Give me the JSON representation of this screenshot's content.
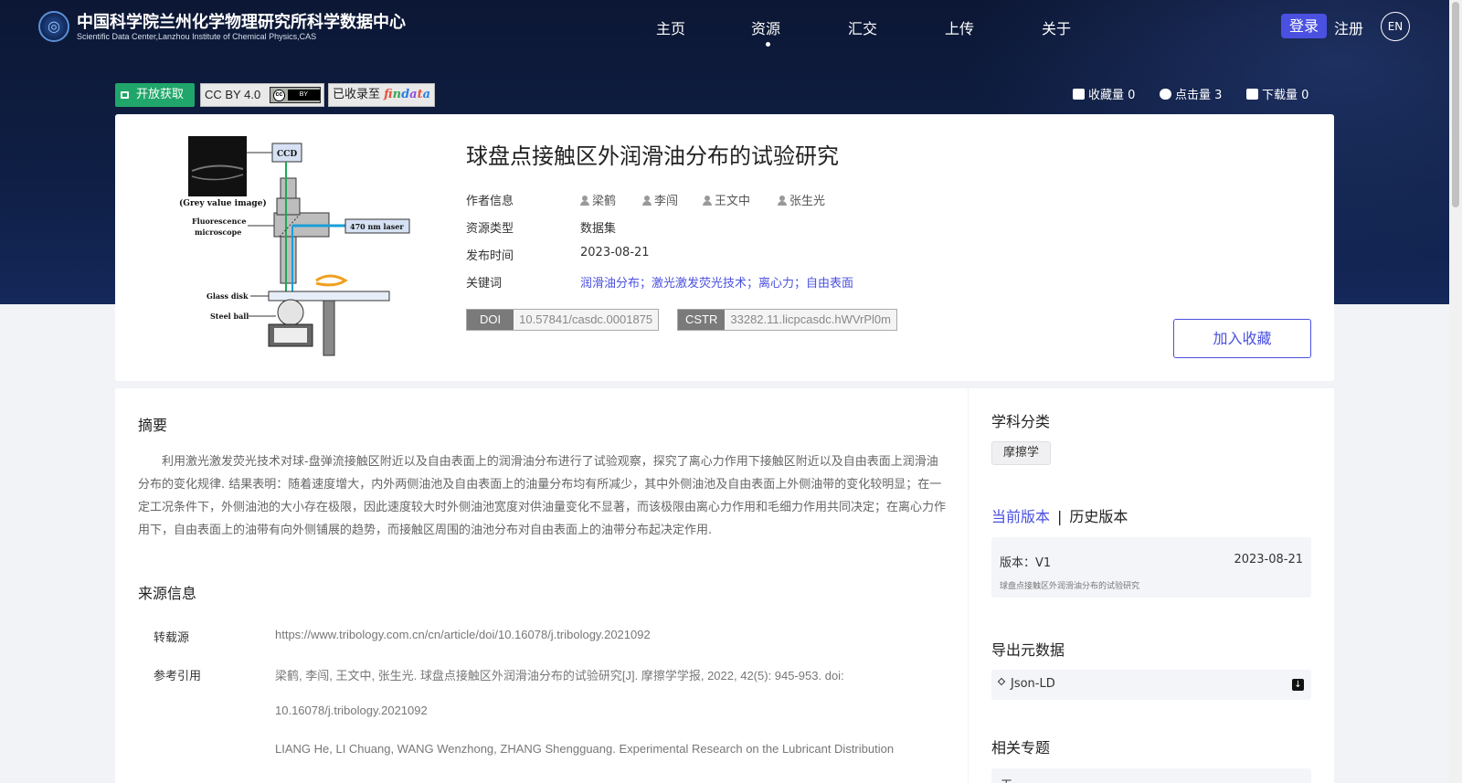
{
  "header": {
    "title": "中国科学院兰州化学物理研究所科学数据中心",
    "subtitle": "Scientific Data Center,Lanzhou Institute of Chemical Physics,CAS",
    "nav": [
      "主页",
      "资源",
      "汇交",
      "上传",
      "关于"
    ],
    "active_nav": "资源",
    "login": "登录",
    "register": "注册",
    "lang": "EN"
  },
  "badges": {
    "open_access": "开放获取",
    "license": "CC BY 4.0",
    "indexed_prefix": "已收录至",
    "indexed_logo": "findata"
  },
  "stats": [
    {
      "icon": "bookmark-icon",
      "label": "收藏量",
      "value": "0"
    },
    {
      "icon": "eye-icon",
      "label": "点击量",
      "value": "3"
    },
    {
      "icon": "download-icon",
      "label": "下载量",
      "value": "0"
    }
  ],
  "resource": {
    "title": "球盘点接触区外润滑油分布的试验研究",
    "labels": {
      "authors": "作者信息",
      "type": "资源类型",
      "date": "发布时间",
      "keywords": "关键词"
    },
    "authors": [
      "梁鹤",
      "李闯",
      "王文中",
      "张生光"
    ],
    "type": "数据集",
    "date": "2023-08-21",
    "keywords": "润滑油分布；激光激发荧光技术；离心力；自由表面",
    "doi_label": "DOI",
    "doi": "10.57841/casdc.0001875",
    "cstr_label": "CSTR",
    "cstr": "33282.11.licpcasdc.hWVrPl0m",
    "favorite_button": "加入收藏"
  },
  "figure": {
    "ccd": "CCD",
    "grey": "(Grey value image)",
    "fluor1": "Fluorescence",
    "fluor2": "microscope",
    "laser": "470 nm laser",
    "glass": "Glass disk",
    "ball": "Steel ball"
  },
  "abstract": {
    "heading": "摘要",
    "text": "利用激光激发荧光技术对球-盘弹流接触区附近以及自由表面上的润滑油分布进行了试验观察，探究了离心力作用下接触区附近以及自由表面上润滑油分布的变化规律. 结果表明：随着速度增大，内外两侧油池及自由表面上的油量分布均有所减少，其中外侧油池及自由表面上外侧油带的变化较明显；在一定工况条件下，外侧油池的大小存在极限，因此速度较大时外侧油池宽度对供油量变化不显著，而该极限由离心力作用和毛细力作用共同决定；在离心力作用下，自由表面上的油带有向外侧铺展的趋势，而接触区周围的油池分布对自由表面上的油带分布起决定作用."
  },
  "source": {
    "heading": "来源信息",
    "reprint_label": "转载源",
    "reprint_url": "https://www.tribology.com.cn/cn/article/doi/10.16078/j.tribology.2021092",
    "citation_label": "参考引用",
    "citation_cn_1": "梁鹤, 李闯, 王文中, 张生光. 球盘点接触区外润滑油分布的试验研究[J]. 摩擦学学报, 2022, 42(5): 945-953. doi:",
    "citation_cn_2": "10.16078/j.tribology.2021092",
    "citation_en_1": "LIANG He, LI Chuang, WANG Wenzhong, ZHANG Shengguang. Experimental Research on the Lubricant Distribution"
  },
  "sidebar": {
    "subject_heading": "学科分类",
    "subject_tag": "摩擦学",
    "tab_current": "当前版本",
    "tab_history": "历史版本",
    "version_label": "版本：V1",
    "version_date": "2023-08-21",
    "version_title": "球盘点接触区外润滑油分布的试验研究",
    "export_heading": "导出元数据",
    "export_option": "Json-LD",
    "related_heading": "相关专题",
    "related_value": "无"
  },
  "colors": {
    "accent": "#4a50e0",
    "open_green": "#20a66a",
    "hero_bg": "#0f1f45"
  }
}
